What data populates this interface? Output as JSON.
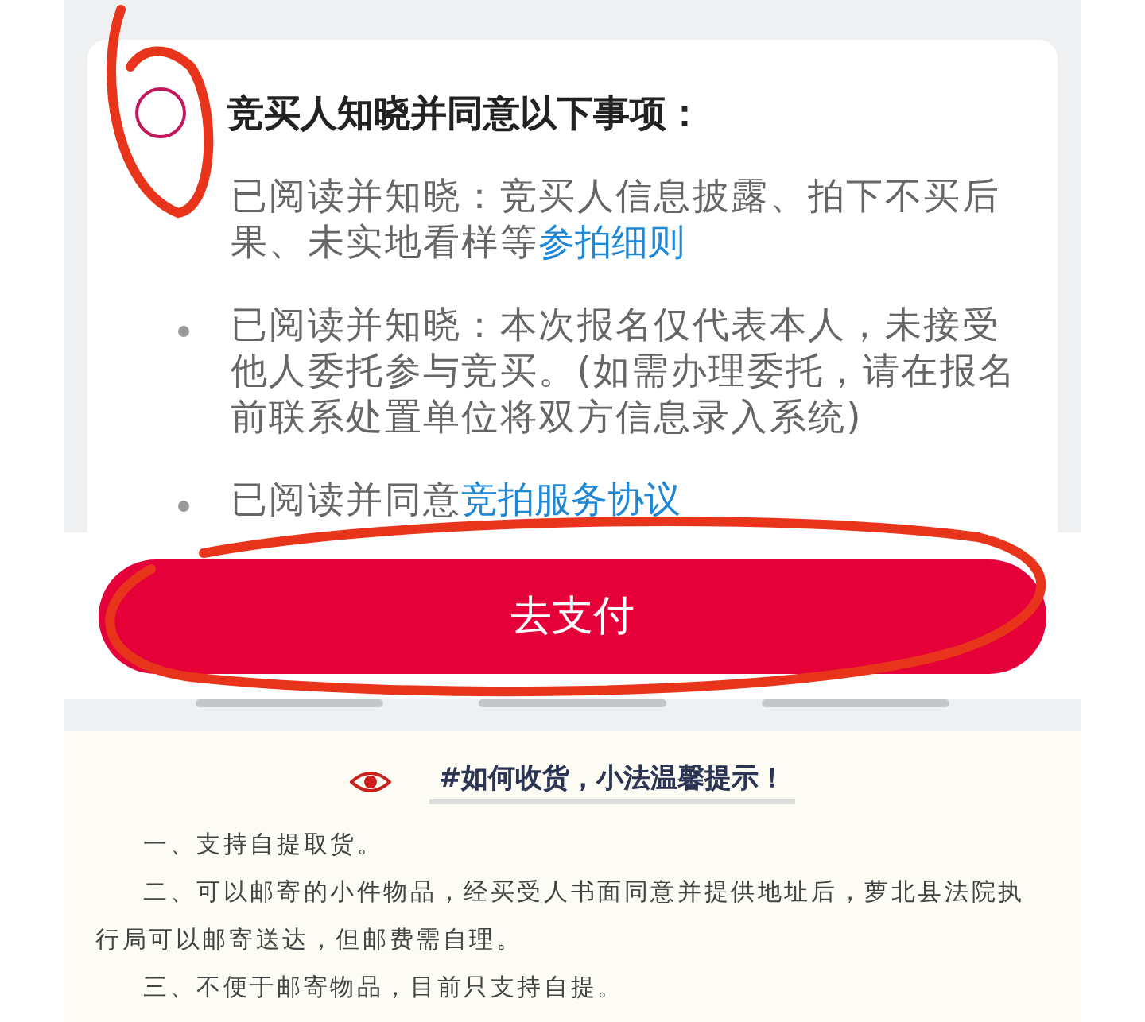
{
  "agreement": {
    "title": "竞买人知晓并同意以下事项：",
    "checked": false,
    "items": [
      {
        "bullet": false,
        "text": "已阅读并知晓：竞买人信息披露、拍下不买后果、未实地看样等",
        "link": "参拍细则"
      },
      {
        "bullet": true,
        "text": "已阅读并知晓：本次报名仅代表本人，未接受他人委托参与竞买。(如需办理委托，请在报名前联系处置单位将双方信息录入系统)"
      },
      {
        "bullet": true,
        "text": "已阅读并同意",
        "link": "竞拍服务协议"
      }
    ]
  },
  "pay_button": "去支付",
  "article": {
    "heading": "#如何收货，小法温馨提示！",
    "paragraphs": [
      "一、支持自提取货。",
      "二、可以邮寄的小件物品，经买受人书面同意并提供地址后，萝北县法院执行局可以邮寄送达，但邮费需自理。",
      "三、不便于邮寄物品，目前只支持自提。"
    ]
  }
}
